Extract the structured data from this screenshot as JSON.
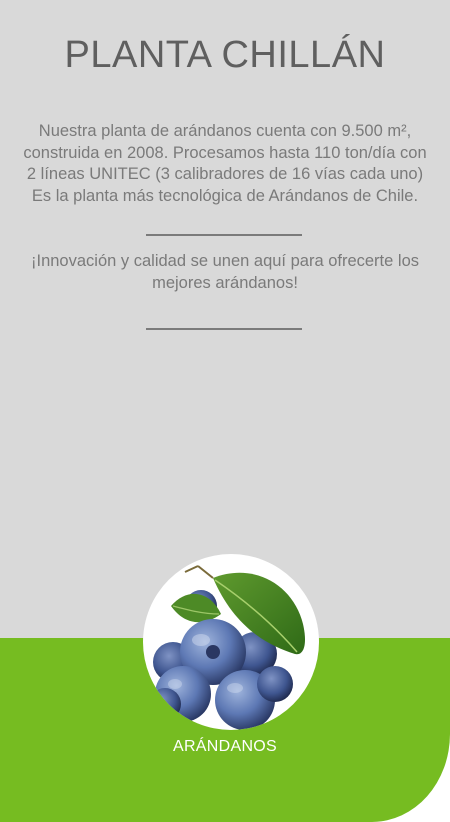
{
  "page": {
    "title": "PLANTA CHILLÁN",
    "description": "Nuestra planta de arándanos cuenta con 9.500 m², construida en 2008. Procesamos hasta 110 ton/día con 2 líneas UNITEC (3 calibradores de 16 vías cada uno) Es la planta más tecnológica de Arándanos de Chile.",
    "tagline": "¡Innovación y calidad se unen aquí para ofrecerte los mejores arándanos!"
  },
  "product": {
    "label": "ARÁNDANOS",
    "image_icon": "blueberry-cluster-icon"
  },
  "colors": {
    "background_gray": "#d9d9d9",
    "accent_green": "#76bc21",
    "title_text": "#5f5f5f",
    "body_text": "#7a7a7a"
  }
}
